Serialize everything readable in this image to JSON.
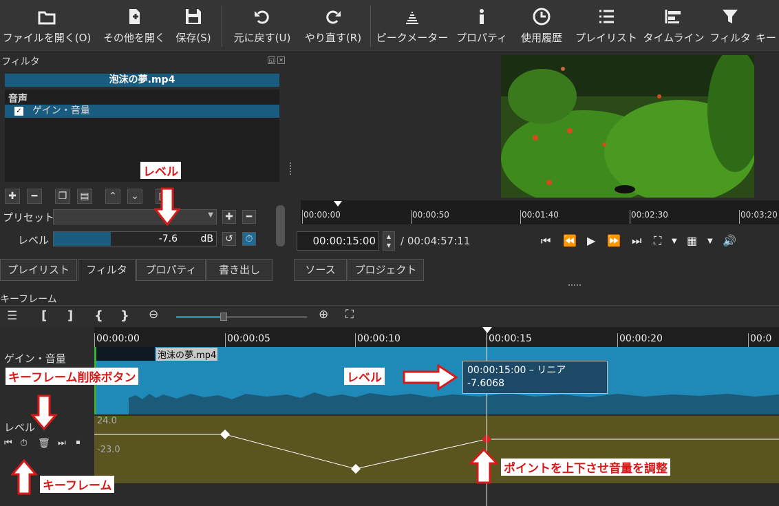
{
  "toolbar": {
    "items": [
      {
        "label": "ファイルを開く(O)",
        "icon": "folder-open-icon"
      },
      {
        "label": "その他を開く",
        "icon": "file-plus-icon"
      },
      {
        "label": "保存(S)",
        "icon": "save-icon"
      },
      {
        "label": "元に戻す(U)",
        "icon": "undo-icon"
      },
      {
        "label": "やり直す(R)",
        "icon": "redo-icon"
      },
      {
        "label": "ピークメーター",
        "icon": "meter-icon"
      },
      {
        "label": "プロパティ",
        "icon": "info-icon"
      },
      {
        "label": "使用履歴",
        "icon": "clock-icon"
      },
      {
        "label": "プレイリスト",
        "icon": "list-icon"
      },
      {
        "label": "タイムライン",
        "icon": "timeline-icon"
      },
      {
        "label": "フィルタ",
        "icon": "funnel-icon"
      },
      {
        "label": "キー",
        "icon": "keyframe-icon"
      }
    ]
  },
  "filters": {
    "title": "フィルタ",
    "file": "泡沫の夢.mp4",
    "category": "音声",
    "item": "ゲイン・音量",
    "preset_label": "プリセット",
    "level_label": "レベル",
    "level_value": "-7.6",
    "level_unit": "dB",
    "level_fill": 0.35
  },
  "player": {
    "ticks": [
      "00:00:00",
      "00:00:50",
      "00:01:40",
      "00:02:30",
      "00:03:20"
    ],
    "current": "00:00:15:00",
    "total": "/ 00:04:57:11"
  },
  "tabs": [
    "プレイリスト",
    "フィルタ",
    "プロパティ",
    "書き出し",
    "ソース",
    "プロジェクト"
  ],
  "keyframes": {
    "title": "キーフレーム",
    "ticks": [
      "00:00:00",
      "00:00:05",
      "00:00:10",
      "00:00:15",
      "00:00:20",
      "00:0"
    ],
    "track1_label": "ゲイン・音量",
    "clip_name": "泡沫の夢.mp4",
    "track2_label": "レベル",
    "y_top": "24.0",
    "y_mid": "-23.0",
    "tooltip_time": "00:00:15:00 – リニア",
    "tooltip_value": "-7.6068"
  },
  "annotations": {
    "level_top": "レベル",
    "delete_btn": "キーフレーム削除ボタン",
    "level_tl": "レベル",
    "keyframe": "キーフレーム",
    "adjust": "ポイントを上下させ音量を調整"
  }
}
